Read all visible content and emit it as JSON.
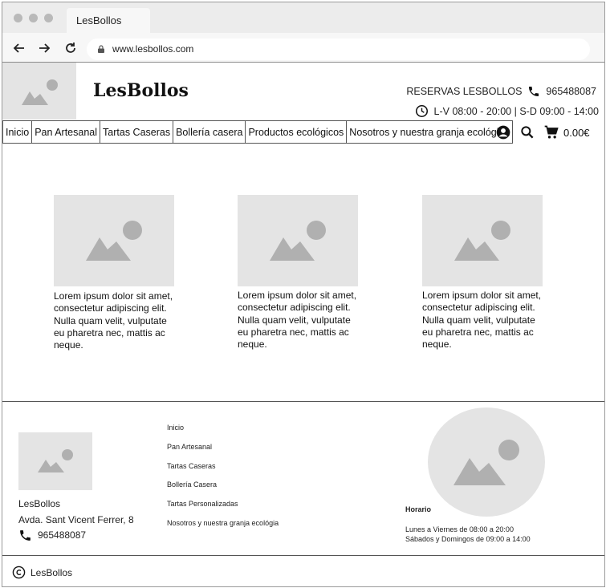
{
  "browser": {
    "tab_title": "LesBollos",
    "url": "www.lesbollos.com"
  },
  "header": {
    "brand": "LesBollos",
    "reservations_label": "RESERVAS LESBOLLOS",
    "phone": "965488087",
    "hours": "L-V 08:00 - 20:00 | S-D 09:00 - 14:00"
  },
  "nav": {
    "items": [
      {
        "label": "Inicio"
      },
      {
        "label": "Pan Artesanal"
      },
      {
        "label": "Tartas Caseras"
      },
      {
        "label": "Bollería casera"
      },
      {
        "label": "Productos ecológicos"
      },
      {
        "label": "Nosotros y nuestra granja ecológica"
      }
    ],
    "cart_total": "0.00€"
  },
  "cards": [
    {
      "text": "Lorem ipsum dolor sit amet, consectetur adipiscing elit. Nulla quam velit, vulputate eu pharetra nec, mattis ac neque."
    },
    {
      "text": "Lorem ipsum dolor sit amet, consectetur adipiscing elit. Nulla quam velit, vulputate eu pharetra nec, mattis ac neque."
    },
    {
      "text": "Lorem ipsum dolor sit amet, consectetur adipiscing elit. Nulla quam velit, vulputate eu pharetra nec, mattis ac neque."
    }
  ],
  "footer": {
    "name": "LesBollos",
    "address": "Avda. Sant Vicent Ferrer, 8",
    "phone": "965488087",
    "links": [
      "Inicio",
      "Pan Artesanal",
      "Tartas Caseras",
      "Bollería Casera",
      "Tartas Personalizadas",
      "Nosotros y nuestra granja ecológia"
    ],
    "schedule_title": "Horario",
    "schedule_weekdays": "Lunes a Viernes de 08:00 a 20:00",
    "schedule_weekend": "Sábados y Domingos de 09:00 a 14:00",
    "copyright": "LesBollos"
  },
  "icons": [
    "back-arrow-icon",
    "forward-arrow-icon",
    "reload-icon",
    "lock-icon",
    "image-placeholder-icon",
    "phone-icon",
    "clock-icon",
    "account-icon",
    "search-icon",
    "cart-icon",
    "copyright-icon"
  ]
}
